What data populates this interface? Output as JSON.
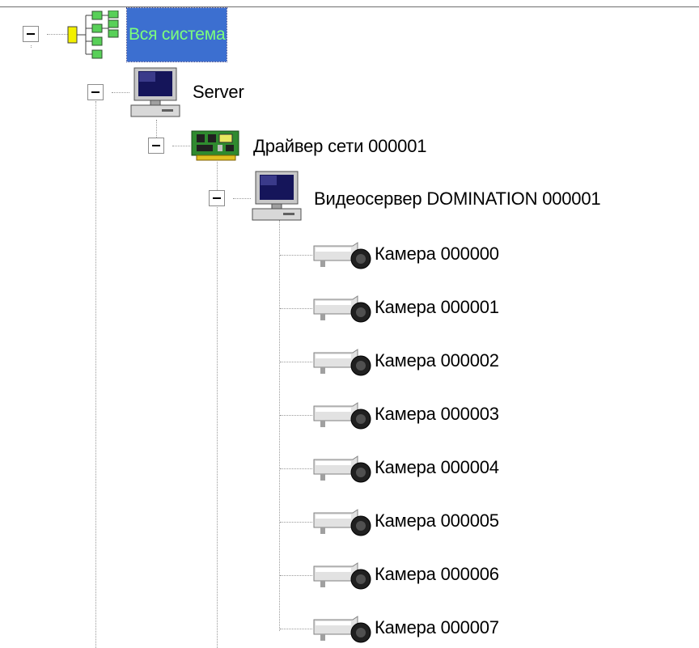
{
  "tree": {
    "root": {
      "label": "Вся система",
      "icon": "system-tree-icon",
      "expanded": true,
      "selected": true
    },
    "server": {
      "label": "Server",
      "icon": "computer-icon",
      "expanded": true
    },
    "driver": {
      "label": "Драйвер сети 000001",
      "icon": "network-card-icon",
      "expanded": true
    },
    "videoserver": {
      "label": "Видеосервер DOMINATION 000001",
      "icon": "computer-icon",
      "expanded": true
    },
    "cameras": [
      {
        "label": "Камера 000000",
        "icon": "camera-icon"
      },
      {
        "label": "Камера 000001",
        "icon": "camera-icon"
      },
      {
        "label": "Камера 000002",
        "icon": "camera-icon"
      },
      {
        "label": "Камера 000003",
        "icon": "camera-icon"
      },
      {
        "label": "Камера 000004",
        "icon": "camera-icon"
      },
      {
        "label": "Камера 000005",
        "icon": "camera-icon"
      },
      {
        "label": "Камера 000006",
        "icon": "camera-icon"
      },
      {
        "label": "Камера 000007",
        "icon": "camera-icon"
      }
    ]
  },
  "colors": {
    "selection_bg": "#3c6fd0",
    "selection_text": "#7cff7c",
    "connector": "#9a9a9a"
  }
}
